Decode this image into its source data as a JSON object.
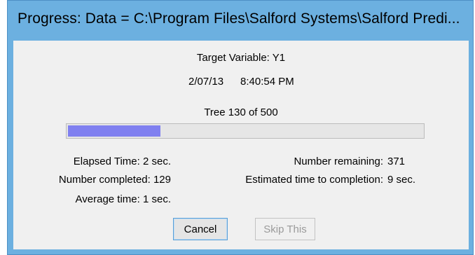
{
  "window": {
    "title": "Progress:  Data = C:\\Program Files\\Salford Systems\\Salford Predi..."
  },
  "header": {
    "target_variable": "Target Variable: Y1",
    "date": "2/07/13",
    "time": "8:40:54 PM"
  },
  "progress": {
    "label": "Tree 130 of 500",
    "fraction": 0.26,
    "fill_color": "#8080f0"
  },
  "stats": {
    "elapsed_time": "Elapsed Time: 2 sec.",
    "number_completed": "Number completed: 129",
    "average_time": "Average time: 1 sec.",
    "number_remaining_label": "Number remaining:",
    "number_remaining_value": "371",
    "estimated_label": "Estimated time to completion:",
    "estimated_value": "9 sec."
  },
  "buttons": {
    "cancel_label": "Cancel",
    "skip_label": "Skip This"
  }
}
